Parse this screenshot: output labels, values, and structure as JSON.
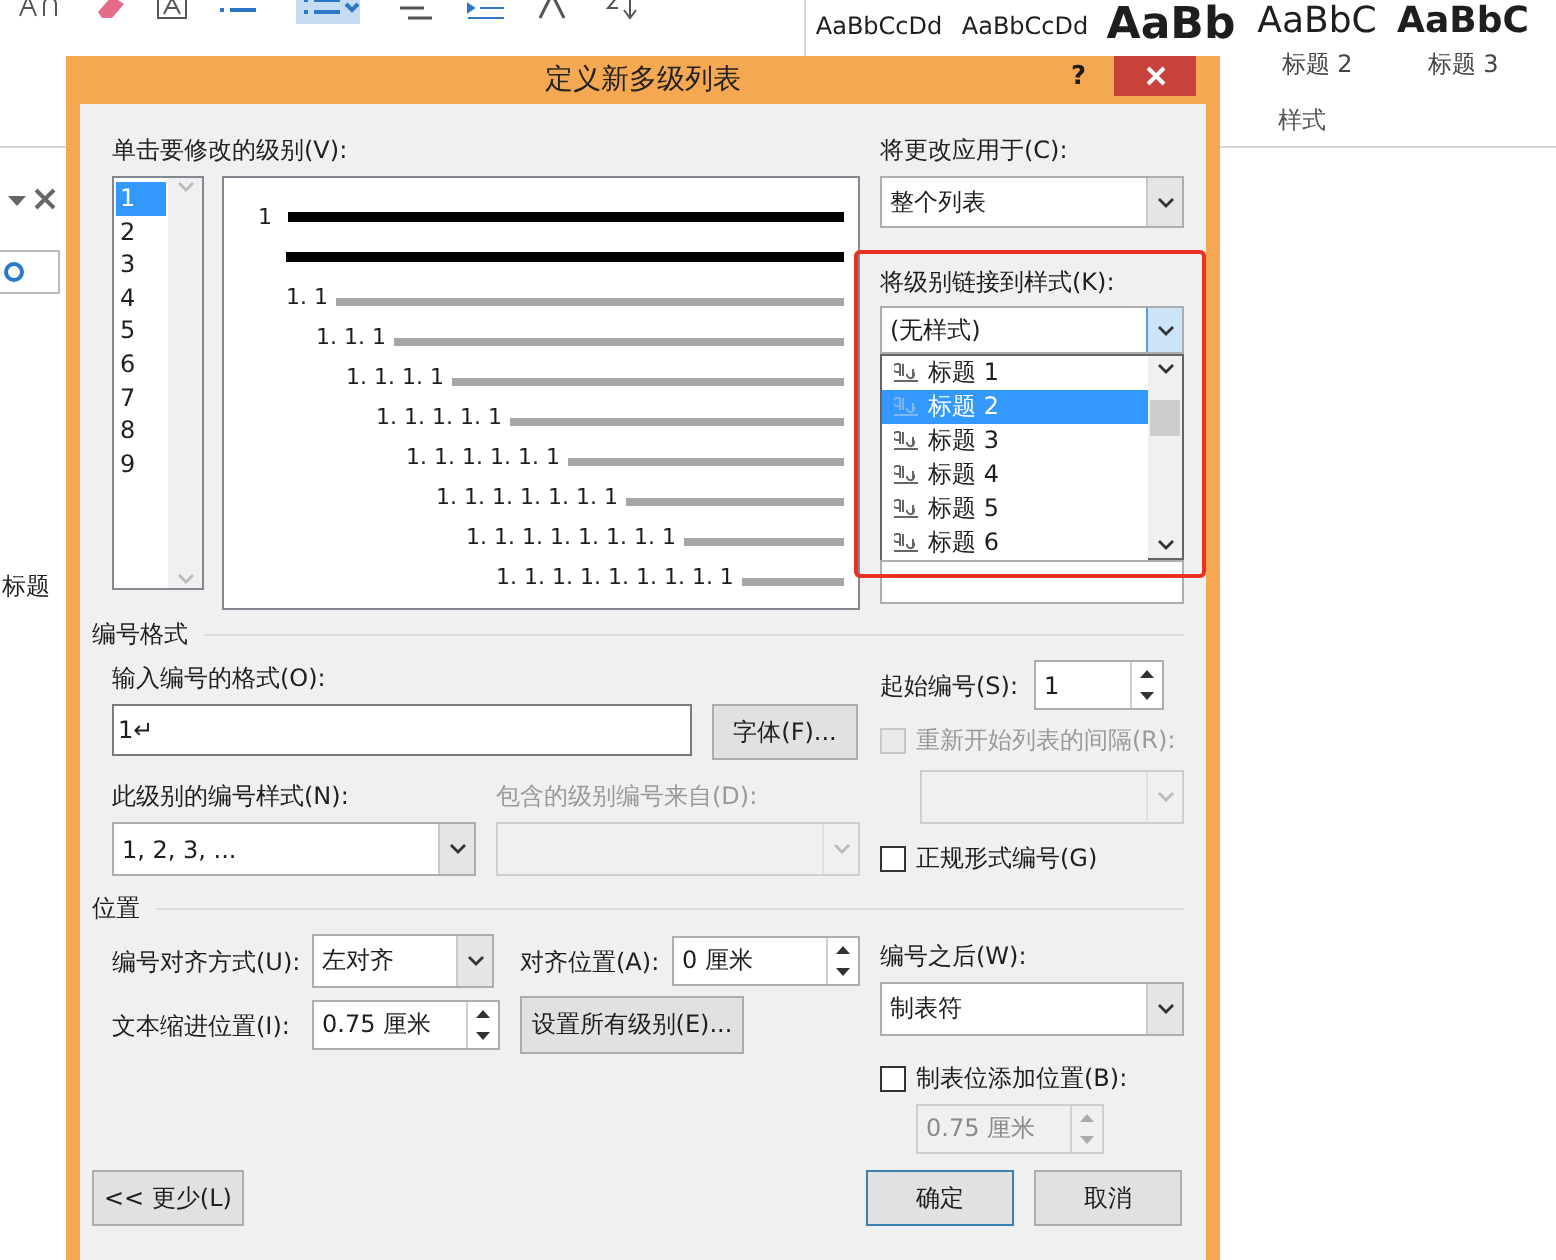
{
  "ribbon": {
    "styles": [
      {
        "sample": "AaBbCcDd",
        "kind": "plain"
      },
      {
        "sample": "AaBbCcDd",
        "kind": "plain"
      },
      {
        "sample": "AaBb",
        "kind": "heading1"
      },
      {
        "sample": "AaBbC",
        "kind": "heading2",
        "caption": "标题 2"
      },
      {
        "sample": "AaBbC",
        "kind": "heading3",
        "caption": "标题 3"
      }
    ],
    "group_label": "样式"
  },
  "pane": {
    "text": "标题"
  },
  "dialog": {
    "title": "定义新多级列表",
    "help": "?",
    "level_label": "单击要修改的级别(V):",
    "levels": [
      {
        "label": "1",
        "selected": true
      },
      {
        "label": "2",
        "selected": false
      },
      {
        "label": "3",
        "selected": false
      },
      {
        "label": "4",
        "selected": false
      },
      {
        "label": "5",
        "selected": false
      },
      {
        "label": "6",
        "selected": false
      },
      {
        "label": "7",
        "selected": false
      },
      {
        "label": "8",
        "selected": false
      },
      {
        "label": "9",
        "selected": false
      }
    ],
    "preview": [
      {
        "number": "1",
        "kind": "current"
      },
      {
        "kind": "continuation"
      },
      {
        "number": "1. 1",
        "kind": "other"
      },
      {
        "number": "1. 1. 1",
        "kind": "other"
      },
      {
        "number": "1. 1. 1. 1",
        "kind": "other"
      },
      {
        "number": "1. 1. 1. 1. 1",
        "kind": "other"
      },
      {
        "number": "1. 1. 1. 1. 1. 1",
        "kind": "other"
      },
      {
        "number": "1. 1. 1. 1. 1. 1. 1",
        "kind": "other"
      },
      {
        "number": "1. 1. 1. 1. 1. 1. 1. 1",
        "kind": "other"
      },
      {
        "number": "1. 1. 1. 1. 1. 1. 1. 1. 1",
        "kind": "other"
      }
    ],
    "apply_label": "将更改应用于(C):",
    "apply_value": "整个列表",
    "link_label": "将级别链接到样式(K):",
    "link_value": "(无样式)",
    "link_options": [
      {
        "label": "标题 1",
        "selected": false
      },
      {
        "label": "标题 2",
        "selected": true
      },
      {
        "label": "标题 3",
        "selected": false
      },
      {
        "label": "标题 4",
        "selected": false
      },
      {
        "label": "标题 5",
        "selected": false
      },
      {
        "label": "标题 6",
        "selected": false
      }
    ],
    "number_format": {
      "heading": "编号格式",
      "format_label": "输入编号的格式(O):",
      "format_value": "1↵",
      "font_button": "字体(F)...",
      "start_label": "起始编号(S):",
      "start_value": "1",
      "restart": {
        "label": "重新开始列表的间隔(R):",
        "checked": false,
        "disabled": true
      },
      "style_label": "此级别的编号样式(N):",
      "style_value": "1, 2, 3, ...",
      "include_label": "包含的级别编号来自(D):",
      "include_disabled": true,
      "legal": {
        "label": "正规形式编号(G)",
        "checked": false
      }
    },
    "position": {
      "heading": "位置",
      "align_label": "编号对齐方式(U):",
      "align_value": "左对齐",
      "at_label": "对齐位置(A):",
      "at_value": "0 厘米",
      "indent_label": "文本缩进位置(I):",
      "indent_value": "0.75 厘米",
      "set_all_button": "设置所有级别(E)...",
      "follow_label": "编号之后(W):",
      "follow_value": "制表符",
      "tab_stop": {
        "label": "制表位添加位置(B):",
        "checked": false
      },
      "tab_value": "0.75 厘米"
    },
    "buttons": [
      {
        "label": "<< 更少(L)",
        "kind": "more"
      },
      {
        "label": "确定",
        "kind": "default"
      },
      {
        "label": "取消",
        "kind": "normal"
      }
    ]
  }
}
